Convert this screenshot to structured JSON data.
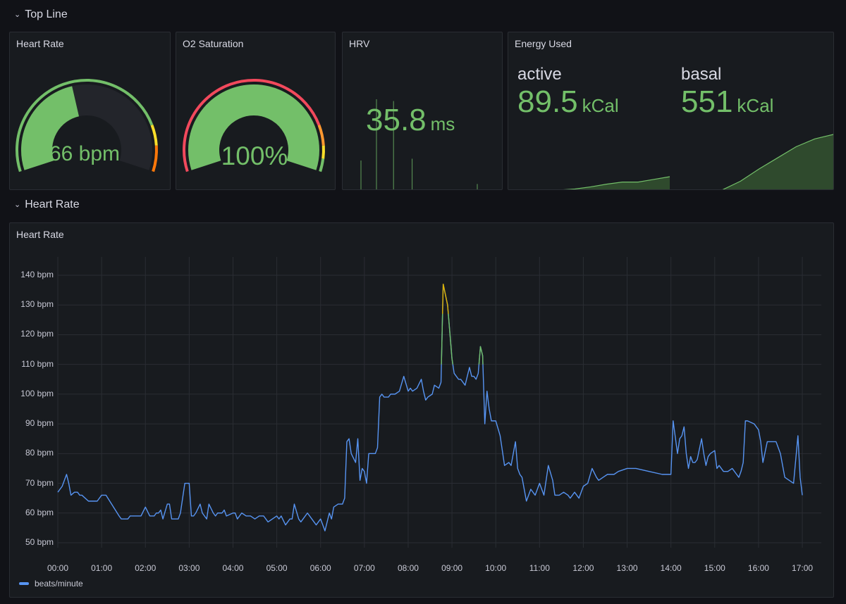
{
  "rows": [
    {
      "title": "Top Line",
      "collapsed": false
    },
    {
      "title": "Heart Rate",
      "collapsed": false
    }
  ],
  "panels": {
    "heart_rate_gauge": {
      "title": "Heart Rate",
      "value": "66",
      "unit": "bpm",
      "display": "66 bpm",
      "min": 0,
      "max": 150,
      "fill_fraction": 0.44,
      "color": "#73bf69",
      "thresholds": [
        {
          "from": 0,
          "to": 0.82,
          "color": "#73bf69"
        },
        {
          "from": 0.82,
          "to": 0.9,
          "color": "#fade2a"
        },
        {
          "from": 0.9,
          "to": 1.0,
          "color": "#ff780a"
        }
      ]
    },
    "o2_gauge": {
      "title": "O2 Saturation",
      "value": "100",
      "unit": "%",
      "display": "100%",
      "fill_fraction": 1.0,
      "color": "#73bf69",
      "thresholds": [
        {
          "from": 0,
          "to": 0.82,
          "color": "#f2495c"
        },
        {
          "from": 0.82,
          "to": 0.9,
          "color": "#ff9830"
        },
        {
          "from": 0.9,
          "to": 0.95,
          "color": "#fade2a"
        },
        {
          "from": 0.95,
          "to": 1.0,
          "color": "#73bf69"
        }
      ]
    },
    "hrv": {
      "title": "HRV",
      "value": "35.8",
      "unit": "ms",
      "color": "#73bf69",
      "sparkline_spikes": [
        {
          "t": 0.1,
          "v": 0.32
        },
        {
          "t": 0.2,
          "v": 1.0
        },
        {
          "t": 0.31,
          "v": 0.98
        },
        {
          "t": 0.43,
          "v": 0.34
        },
        {
          "t": 0.85,
          "v": 0.06
        }
      ]
    },
    "energy": {
      "title": "Energy Used",
      "stats": [
        {
          "label": "active",
          "value": "89.5",
          "unit": "kCal",
          "spark": [
            0,
            0.04,
            0.12,
            0.22,
            0.3,
            0.3,
            0.4,
            0.5
          ]
        },
        {
          "label": "basal",
          "value": "551",
          "unit": "kCal",
          "spark": [
            0,
            0.16,
            0.38,
            0.58,
            0.78,
            0.92,
            1.0
          ]
        }
      ]
    },
    "heart_rate_chart": {
      "title": "Heart Rate",
      "legend": "beats/minute"
    }
  },
  "chart_data": {
    "type": "line",
    "title": "Heart Rate",
    "xlabel": "",
    "ylabel": "",
    "ylim": [
      45,
      145
    ],
    "y_ticks": [
      "140 bpm",
      "130 bpm",
      "120 bpm",
      "110 bpm",
      "100 bpm",
      "90 bpm",
      "80 bpm",
      "70 bpm",
      "60 bpm",
      "50 bpm"
    ],
    "y_tick_values": [
      140,
      130,
      120,
      110,
      100,
      90,
      80,
      70,
      60,
      50
    ],
    "x_ticks": [
      "00:00",
      "01:00",
      "02:00",
      "03:00",
      "04:00",
      "05:00",
      "06:00",
      "07:00",
      "08:00",
      "09:00",
      "10:00",
      "11:00",
      "12:00",
      "13:00",
      "14:00",
      "15:00",
      "16:00",
      "17:00"
    ],
    "grid": true,
    "legend_position": "bottom-left",
    "thresholds": [
      {
        "above": 0,
        "color": "#5794f2"
      },
      {
        "above": 110,
        "color": "#73bf69"
      },
      {
        "above": 127,
        "color": "#e0b400"
      }
    ],
    "series": [
      {
        "name": "beats/minute",
        "color": "#5794f2",
        "x_hours": [
          0.0,
          0.05,
          0.1,
          0.2,
          0.25,
          0.3,
          0.38,
          0.45,
          0.5,
          0.55,
          0.7,
          0.75,
          0.9,
          1.0,
          1.1,
          1.4,
          1.45,
          1.55,
          1.6,
          1.65,
          1.75,
          1.9,
          2.0,
          2.1,
          2.2,
          2.25,
          2.3,
          2.35,
          2.4,
          2.5,
          2.55,
          2.6,
          2.65,
          2.75,
          2.8,
          2.9,
          3.0,
          3.05,
          3.1,
          3.15,
          3.25,
          3.3,
          3.4,
          3.45,
          3.55,
          3.6,
          3.65,
          3.75,
          3.8,
          3.85,
          4.0,
          4.05,
          4.1,
          4.2,
          4.3,
          4.4,
          4.5,
          4.6,
          4.7,
          4.8,
          5.0,
          5.05,
          5.1,
          5.2,
          5.3,
          5.35,
          5.4,
          5.5,
          5.55,
          5.6,
          5.7,
          5.8,
          5.9,
          6.0,
          6.05,
          6.1,
          6.2,
          6.25,
          6.3,
          6.4,
          6.5,
          6.55,
          6.6,
          6.65,
          6.7,
          6.8,
          6.85,
          6.9,
          6.95,
          7.0,
          7.05,
          7.1,
          7.15,
          7.25,
          7.3,
          7.35,
          7.4,
          7.45,
          7.5,
          7.55,
          7.6,
          7.7,
          7.8,
          7.9,
          8.0,
          8.05,
          8.1,
          8.2,
          8.3,
          8.35,
          8.4,
          8.45,
          8.55,
          8.6,
          8.7,
          8.75,
          8.8,
          8.9,
          9.0,
          9.05,
          9.1,
          9.15,
          9.2,
          9.3,
          9.4,
          9.45,
          9.5,
          9.55,
          9.6,
          9.65,
          9.7,
          9.75,
          9.8,
          9.85,
          9.9,
          9.95,
          10.0,
          10.1,
          10.2,
          10.3,
          10.35,
          10.45,
          10.5,
          10.55,
          10.6,
          10.65,
          10.7,
          10.8,
          10.9,
          11.0,
          11.05,
          11.1,
          11.2,
          11.3,
          11.35,
          11.45,
          11.55,
          11.65,
          11.7,
          11.8,
          11.9,
          12.0,
          12.1,
          12.2,
          12.3,
          12.35,
          12.45,
          12.55,
          12.6,
          12.7,
          12.8,
          13.0,
          13.2,
          13.5,
          13.8,
          13.9,
          14.0,
          14.05,
          14.15,
          14.2,
          14.25,
          14.3,
          14.35,
          14.4,
          14.45,
          14.5,
          14.55,
          14.6,
          14.7,
          14.75,
          14.8,
          14.85,
          14.9,
          15.0,
          15.05,
          15.1,
          15.2,
          15.3,
          15.4,
          15.5,
          15.55,
          15.6,
          15.65,
          15.7,
          15.75,
          15.9,
          16.0,
          16.05,
          16.1,
          16.2,
          16.3,
          16.4,
          16.5,
          16.55,
          16.6,
          16.7,
          16.8,
          16.9,
          16.95,
          17.0
        ],
        "values": [
          67,
          68,
          69,
          73,
          70,
          66,
          67,
          67,
          66,
          66,
          64,
          64,
          64,
          66,
          66,
          59,
          58,
          58,
          58,
          59,
          59,
          59,
          62,
          59,
          59,
          60,
          60,
          61,
          58,
          63,
          63,
          58,
          58,
          58,
          60,
          70,
          70,
          59,
          59,
          60,
          63,
          60,
          58,
          63,
          60,
          59,
          60,
          60,
          61,
          59,
          60,
          60,
          58,
          60,
          59,
          59,
          58,
          59,
          59,
          57,
          59,
          58,
          59,
          56,
          58,
          58,
          63,
          58,
          57,
          58,
          60,
          58,
          56,
          58,
          56,
          54,
          60,
          58,
          62,
          63,
          63,
          65,
          84,
          85,
          80,
          77,
          85,
          71,
          75,
          74,
          70,
          80,
          80,
          80,
          82,
          99,
          100,
          99,
          99,
          99,
          100,
          100,
          101,
          106,
          101,
          102,
          101,
          102,
          105,
          101,
          98,
          99,
          100,
          103,
          102,
          104,
          137,
          130,
          112,
          107,
          106,
          105,
          105,
          103,
          109,
          106,
          106,
          105,
          107,
          116,
          113,
          90,
          101,
          95,
          91,
          91,
          91,
          86,
          76,
          77,
          76,
          84,
          75,
          73,
          72,
          68,
          64,
          68,
          66,
          70,
          68,
          66,
          76,
          71,
          66,
          66,
          67,
          66,
          65,
          67,
          65,
          69,
          70,
          75,
          72,
          71,
          72,
          73,
          73,
          73,
          74,
          75,
          75,
          74,
          73,
          73,
          73,
          91,
          80,
          85,
          86,
          89,
          80,
          75,
          79,
          77,
          77,
          78,
          85,
          80,
          76,
          79,
          80,
          81,
          75,
          76,
          74,
          74,
          75,
          73,
          72,
          74,
          77,
          91,
          91,
          90,
          88,
          84,
          77,
          84,
          84,
          84,
          80,
          76,
          72,
          71,
          70,
          86,
          72,
          66
        ]
      }
    ]
  }
}
